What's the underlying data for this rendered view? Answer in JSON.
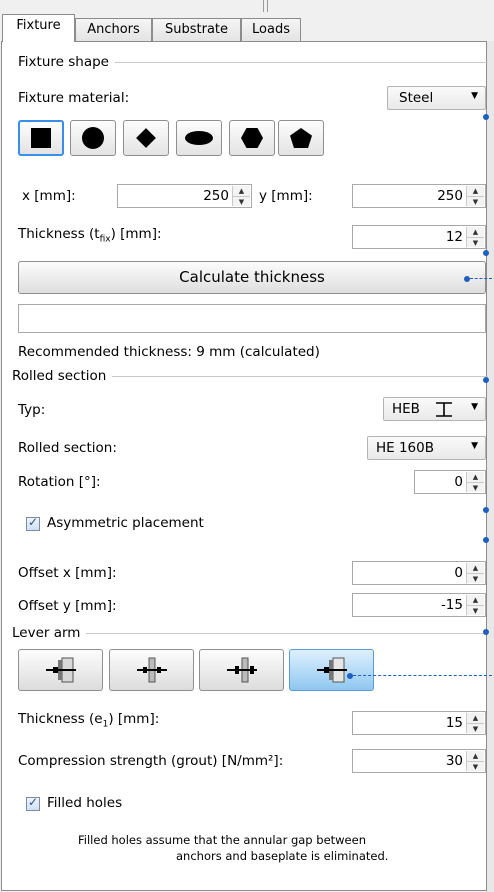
{
  "tabs": [
    "Fixture",
    "Anchors",
    "Substrate",
    "Loads"
  ],
  "fixture_shape": {
    "group_title": "Fixture shape",
    "material_label": "Fixture material:",
    "material_value": "Steel",
    "shapes": [
      "square-shape-icon",
      "circle-shape-icon",
      "diamond-shape-icon",
      "ellipse-shape-icon",
      "hexagon-shape-icon",
      "pentagon-shape-icon"
    ],
    "x_label": "x [mm]:",
    "x_value": "250",
    "y_label": "y [mm]:",
    "y_value": "250",
    "thickness_label_pre": "Thickness (t",
    "thickness_label_sub": "fix",
    "thickness_label_post": ") [mm]:",
    "thickness_value": "12",
    "calc_button": "Calculate thickness",
    "result_field": "",
    "recommended": "Recommended thickness: 9 mm (calculated)"
  },
  "rolled_section": {
    "group_title": "Rolled section",
    "typ_label": "Typ:",
    "typ_value": "HEB",
    "section_label": "Rolled section:",
    "section_value": "HE 160B",
    "rotation_label": "Rotation [°]:",
    "rotation_value": "0",
    "asym_label": "Asymmetric placement",
    "asym_checked": true,
    "offset_x_label": "Offset x [mm]:",
    "offset_x_value": "0",
    "offset_y_label": "Offset y [mm]:",
    "offset_y_value": "-15"
  },
  "lever_arm": {
    "group_title": "Lever arm",
    "thickness_label_pre": "Thickness (e",
    "thickness_label_sub": "1",
    "thickness_label_post": ") [mm]:",
    "thickness_value": "15",
    "compression_label": "Compression strength (grout) [N/mm²]:",
    "compression_value": "30",
    "filled_label": "Filled holes",
    "filled_checked": true,
    "note_line1": "Filled holes assume that the annular gap between",
    "note_line2": "anchors and baseplate is eliminated."
  },
  "colors": {
    "accent": "#3a8ee6",
    "callout": "#1f5fbf",
    "selected_button": "#8fc7f0"
  }
}
